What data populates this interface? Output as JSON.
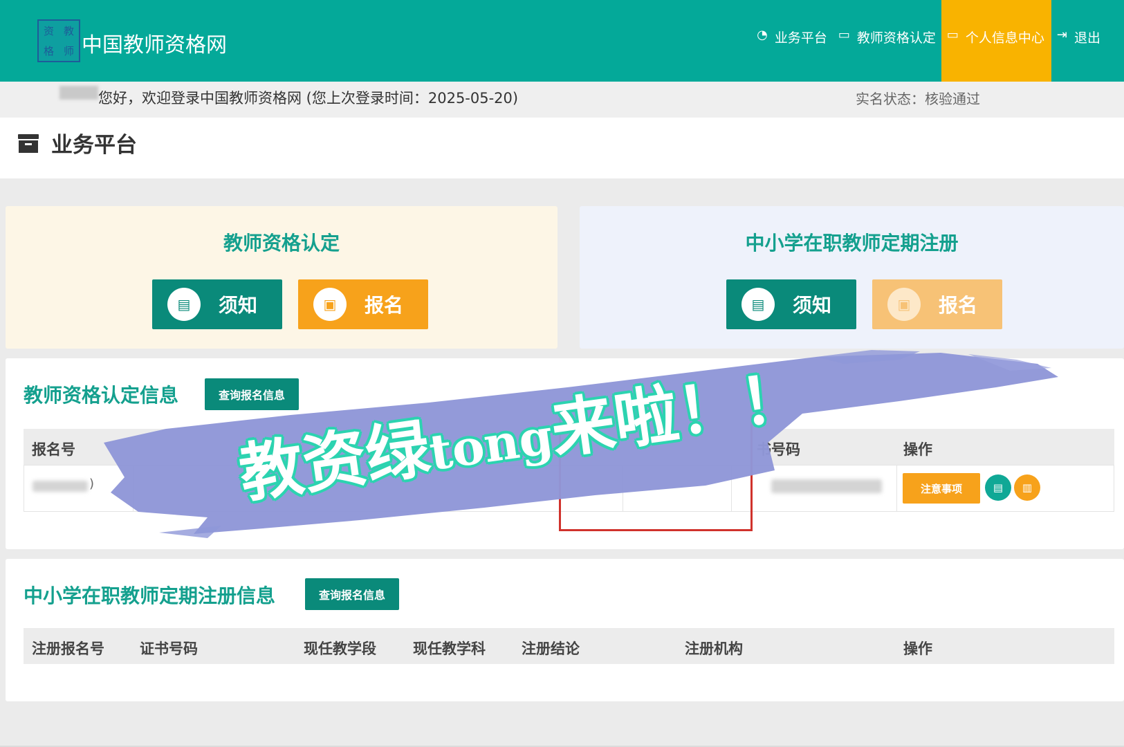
{
  "header": {
    "logo_chars": [
      "资",
      "教",
      "格",
      "师"
    ],
    "site_name": "中国教师资格网",
    "nav": [
      {
        "label": "业务平台",
        "icon": "dashboard-icon",
        "glyph": "◔"
      },
      {
        "label": "教师资格认定",
        "icon": "laptop-icon",
        "glyph": "▭"
      },
      {
        "label": "个人信息中心",
        "icon": "laptop-icon",
        "glyph": "▭",
        "active": true
      },
      {
        "label": "退出",
        "icon": "logout-icon",
        "glyph": "⇥"
      }
    ],
    "colors": {
      "bar": "#04a999",
      "active": "#f9b300"
    }
  },
  "welcome": {
    "greeting": "您好，欢迎登录中国教师资格网 (您上次登录时间：2025-05-20)",
    "realname_status": "实名状态：核验通过"
  },
  "page": {
    "title": "业务平台"
  },
  "panels": {
    "left": {
      "title": "教师资格认定",
      "notice_label": "须知",
      "signup_label": "报名"
    },
    "right": {
      "title": "中小学在职教师定期注册",
      "notice_label": "须知",
      "signup_label": "报名"
    }
  },
  "cert_info": {
    "title": "教师资格认定信息",
    "query_label": "查询报名信息",
    "headers": [
      "报名号",
      "书号码",
      "操作"
    ],
    "row": {
      "partial": ")",
      "notice_btn": "注意事项"
    }
  },
  "register_info": {
    "title": "中小学在职教师定期注册信息",
    "query_label": "查询报名信息",
    "headers": [
      "注册报名号",
      "证书号码",
      "现任教学段",
      "现任教学科",
      "注册结论",
      "注册机构",
      "操作"
    ]
  },
  "overlay": {
    "text_cjk_1": "教资绿",
    "text_latin": "tong",
    "text_cjk_2": "来啦！！",
    "colors": {
      "brush": "#8f97d8",
      "outline": "#2cd3b0"
    }
  }
}
